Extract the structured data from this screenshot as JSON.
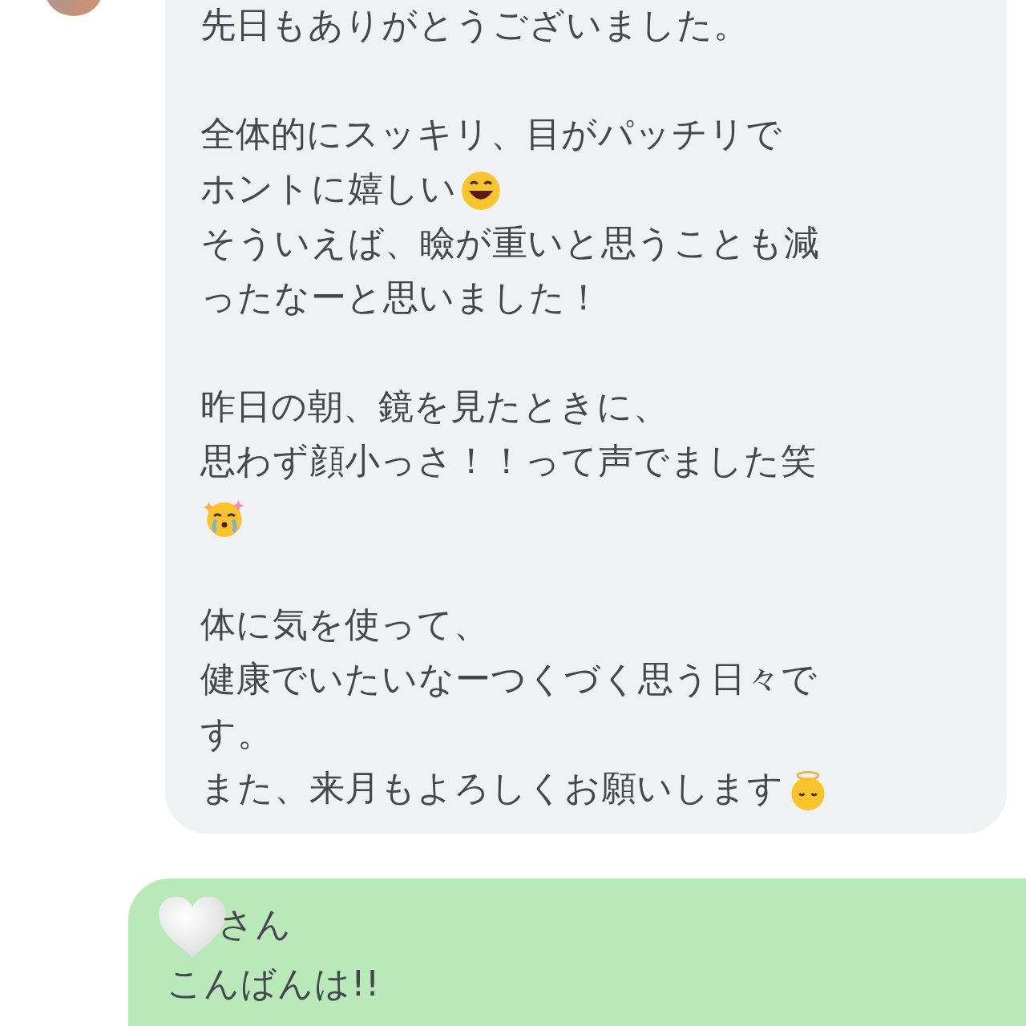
{
  "messages": [
    {
      "kind": "received",
      "paragraphs": [
        {
          "lines": [
            [
              {
                "kind": "text",
                "text": "先日もありがとうございました。"
              }
            ]
          ]
        },
        {
          "lines": [
            [
              {
                "kind": "text",
                "text": "全体的にスッキリ、目がパッチリで"
              }
            ],
            [
              {
                "kind": "text",
                "text": "ホントに嬉しい"
              },
              {
                "kind": "laughing"
              }
            ],
            [
              {
                "kind": "text",
                "text": "そういえば、瞼が重いと思うことも減"
              }
            ],
            [
              {
                "kind": "text",
                "text": "ったなーと思いました！"
              }
            ]
          ]
        },
        {
          "lines": [
            [
              {
                "kind": "text",
                "text": "昨日の朝、鏡を見たときに、"
              }
            ],
            [
              {
                "kind": "text",
                "text": "思わず顔小っさ！！って声でました笑"
              }
            ],
            [
              {
                "kind": "tearful"
              }
            ]
          ]
        },
        {
          "lines": [
            [
              {
                "kind": "text",
                "text": "体に気を使って、"
              }
            ],
            [
              {
                "kind": "text",
                "text": "健康でいたいなーつくづく思う日々で"
              }
            ],
            [
              {
                "kind": "text",
                "text": "す。"
              }
            ],
            [
              {
                "kind": "text",
                "text": "また、来月もよろしくお願いします"
              },
              {
                "kind": "angel"
              }
            ]
          ]
        }
      ]
    },
    {
      "kind": "sent",
      "paragraphs": [
        {
          "lines": [
            [
              {
                "kind": "heart"
              },
              {
                "kind": "text",
                "text": "さん"
              }
            ],
            [
              {
                "kind": "text",
                "text": "こんばんは!!"
              }
            ]
          ]
        }
      ]
    }
  ]
}
